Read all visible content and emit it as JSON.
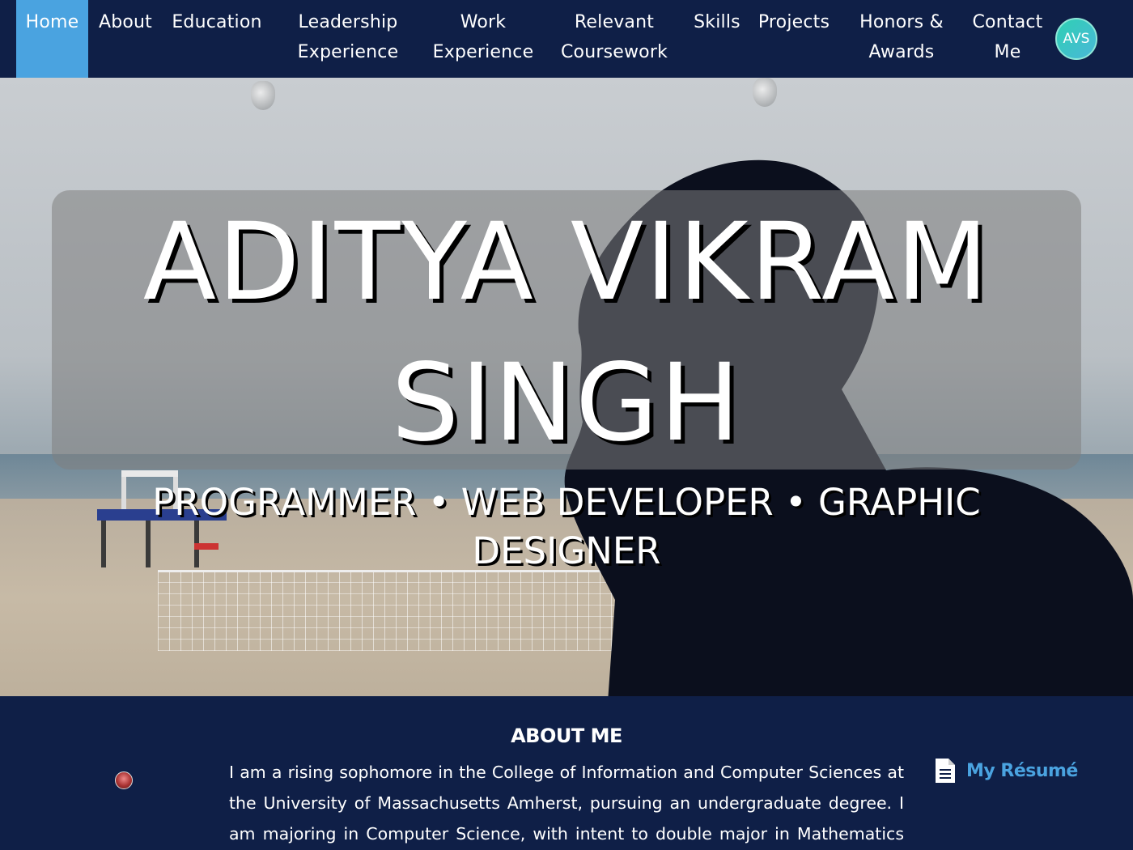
{
  "nav": {
    "items": [
      {
        "line1": "Home",
        "line2": ""
      },
      {
        "line1": "About",
        "line2": ""
      },
      {
        "line1": "Education",
        "line2": ""
      },
      {
        "line1": "Leadership",
        "line2": "Experience"
      },
      {
        "line1": "Work",
        "line2": "Experience"
      },
      {
        "line1": "Relevant",
        "line2": "Coursework"
      },
      {
        "line1": "Skills",
        "line2": ""
      },
      {
        "line1": "Projects",
        "line2": ""
      },
      {
        "line1": "Honors &",
        "line2": "Awards"
      },
      {
        "line1": "Contact",
        "line2": "Me"
      }
    ],
    "active": "Home",
    "logo_text": "AVS"
  },
  "hero": {
    "name_line1": "ADITYA VIKRAM",
    "name_line2": "SINGH",
    "tagline_line1": "PROGRAMMER • WEB DEVELOPER • GRAPHIC",
    "tagline_line2": "DESIGNER"
  },
  "about": {
    "title": "ABOUT ME",
    "text": "I am a rising sophomore in the College of Information and Computer Sciences at the University of Massachusetts Amherst, pursuing an undergraduate degree. I am majoring in Computer Science, with intent to double major in Mathematics with",
    "resume_icon": "document-icon",
    "resume_label": "My Résumé"
  },
  "colors": {
    "nav_bg": "#0f1f47",
    "active_tab": "#4aa3e0",
    "link": "#4aa3e0",
    "logo": "#2fd0b4"
  }
}
